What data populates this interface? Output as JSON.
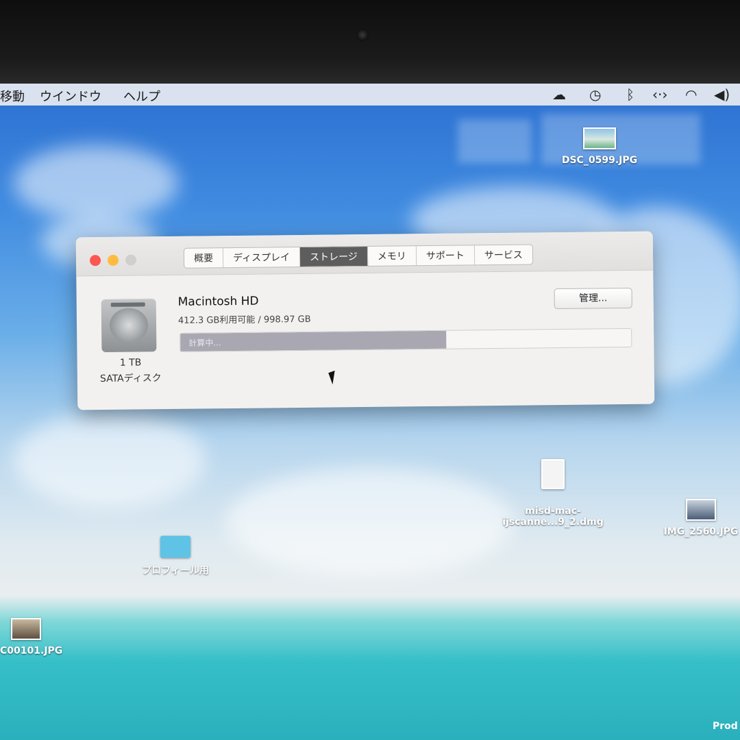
{
  "menubar": {
    "items": [
      "移動",
      "ウインドウ",
      "ヘルプ"
    ],
    "tray_icons": [
      "cloud-upload-icon",
      "time-machine-icon",
      "bluetooth-icon",
      "code-icon",
      "wifi-icon",
      "volume-icon"
    ]
  },
  "desktop": {
    "icons": [
      {
        "label": "DSC_0599.JPG",
        "type": "image"
      },
      {
        "label": "misd-mac-\nijscanne...9_2.dmg",
        "type": "dmg"
      },
      {
        "label": "IMG_2560.JPG",
        "type": "image"
      },
      {
        "label": "プロフィール用",
        "type": "folder"
      },
      {
        "label": "C00101.JPG",
        "type": "image"
      }
    ],
    "corner_text": "Prod"
  },
  "window": {
    "tabs": [
      "概要",
      "ディスプレイ",
      "ストレージ",
      "メモリ",
      "サポート",
      "サービス"
    ],
    "active_tab": "ストレージ",
    "disk": {
      "capacity": "1 TB",
      "type": "SATAディスク"
    },
    "volume": {
      "name": "Macintosh HD",
      "info": "412.3 GB利用可能 / 998.97 GB",
      "used_fraction": 0.59,
      "bar_label": "計算中..."
    },
    "manage_button": "管理..."
  },
  "colors": {
    "close": "#fc5753",
    "minimize": "#fdbc40",
    "zoom": "#cfcfcf",
    "active_tab": "#5d5d5d"
  }
}
